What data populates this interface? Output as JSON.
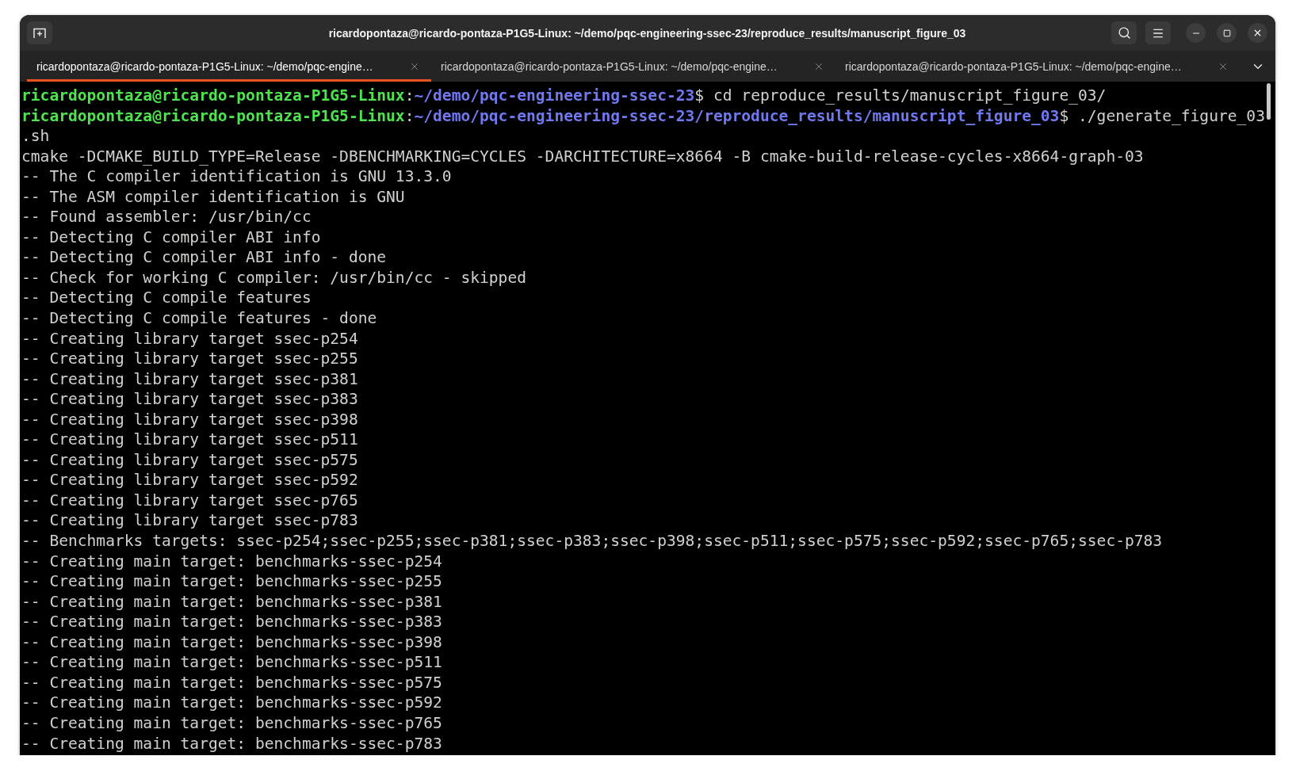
{
  "window": {
    "title": "ricardopontaza@ricardo-pontaza-P1G5-Linux: ~/demo/pqc-engineering-ssec-23/reproduce_results/manuscript_figure_03"
  },
  "tabs": [
    {
      "label": "ricardopontaza@ricardo-pontaza-P1G5-Linux: ~/demo/pqc-engine…",
      "selected": true
    },
    {
      "label": "ricardopontaza@ricardo-pontaza-P1G5-Linux: ~/demo/pqc-engine…",
      "selected": false
    },
    {
      "label": "ricardopontaza@ricardo-pontaza-P1G5-Linux: ~/demo/pqc-engine…",
      "selected": false
    }
  ],
  "terminal": {
    "lines": [
      {
        "kind": "prompt",
        "user": "ricardopontaza@ricardo-pontaza-P1G5-Linux",
        "separator": ":",
        "path": "~/demo/pqc-engineering-ssec-23",
        "command": "$ cd reproduce_results/manuscript_figure_03/"
      },
      {
        "kind": "prompt",
        "user": "ricardopontaza@ricardo-pontaza-P1G5-Linux",
        "separator": ":",
        "path": "~/demo/pqc-engineering-ssec-23/reproduce_results/manuscript_figure_03",
        "command": "$ ./generate_figure_03"
      },
      {
        "kind": "output",
        "text": ".sh"
      },
      {
        "kind": "output",
        "text": "cmake -DCMAKE_BUILD_TYPE=Release -DBENCHMARKING=CYCLES -DARCHITECTURE=x8664 -B cmake-build-release-cycles-x8664-graph-03"
      },
      {
        "kind": "output",
        "text": "-- The C compiler identification is GNU 13.3.0"
      },
      {
        "kind": "output",
        "text": "-- The ASM compiler identification is GNU"
      },
      {
        "kind": "output",
        "text": "-- Found assembler: /usr/bin/cc"
      },
      {
        "kind": "output",
        "text": "-- Detecting C compiler ABI info"
      },
      {
        "kind": "output",
        "text": "-- Detecting C compiler ABI info - done"
      },
      {
        "kind": "output",
        "text": "-- Check for working C compiler: /usr/bin/cc - skipped"
      },
      {
        "kind": "output",
        "text": "-- Detecting C compile features"
      },
      {
        "kind": "output",
        "text": "-- Detecting C compile features - done"
      },
      {
        "kind": "output",
        "text": "-- Creating library target ssec-p254"
      },
      {
        "kind": "output",
        "text": "-- Creating library target ssec-p255"
      },
      {
        "kind": "output",
        "text": "-- Creating library target ssec-p381"
      },
      {
        "kind": "output",
        "text": "-- Creating library target ssec-p383"
      },
      {
        "kind": "output",
        "text": "-- Creating library target ssec-p398"
      },
      {
        "kind": "output",
        "text": "-- Creating library target ssec-p511"
      },
      {
        "kind": "output",
        "text": "-- Creating library target ssec-p575"
      },
      {
        "kind": "output",
        "text": "-- Creating library target ssec-p592"
      },
      {
        "kind": "output",
        "text": "-- Creating library target ssec-p765"
      },
      {
        "kind": "output",
        "text": "-- Creating library target ssec-p783"
      },
      {
        "kind": "output",
        "text": "-- Benchmarks targets: ssec-p254;ssec-p255;ssec-p381;ssec-p383;ssec-p398;ssec-p511;ssec-p575;ssec-p592;ssec-p765;ssec-p783"
      },
      {
        "kind": "output",
        "text": "-- Creating main target: benchmarks-ssec-p254"
      },
      {
        "kind": "output",
        "text": "-- Creating main target: benchmarks-ssec-p255"
      },
      {
        "kind": "output",
        "text": "-- Creating main target: benchmarks-ssec-p381"
      },
      {
        "kind": "output",
        "text": "-- Creating main target: benchmarks-ssec-p383"
      },
      {
        "kind": "output",
        "text": "-- Creating main target: benchmarks-ssec-p398"
      },
      {
        "kind": "output",
        "text": "-- Creating main target: benchmarks-ssec-p511"
      },
      {
        "kind": "output",
        "text": "-- Creating main target: benchmarks-ssec-p575"
      },
      {
        "kind": "output",
        "text": "-- Creating main target: benchmarks-ssec-p592"
      },
      {
        "kind": "output",
        "text": "-- Creating main target: benchmarks-ssec-p765"
      },
      {
        "kind": "output",
        "text": "-- Creating main target: benchmarks-ssec-p783"
      }
    ]
  }
}
